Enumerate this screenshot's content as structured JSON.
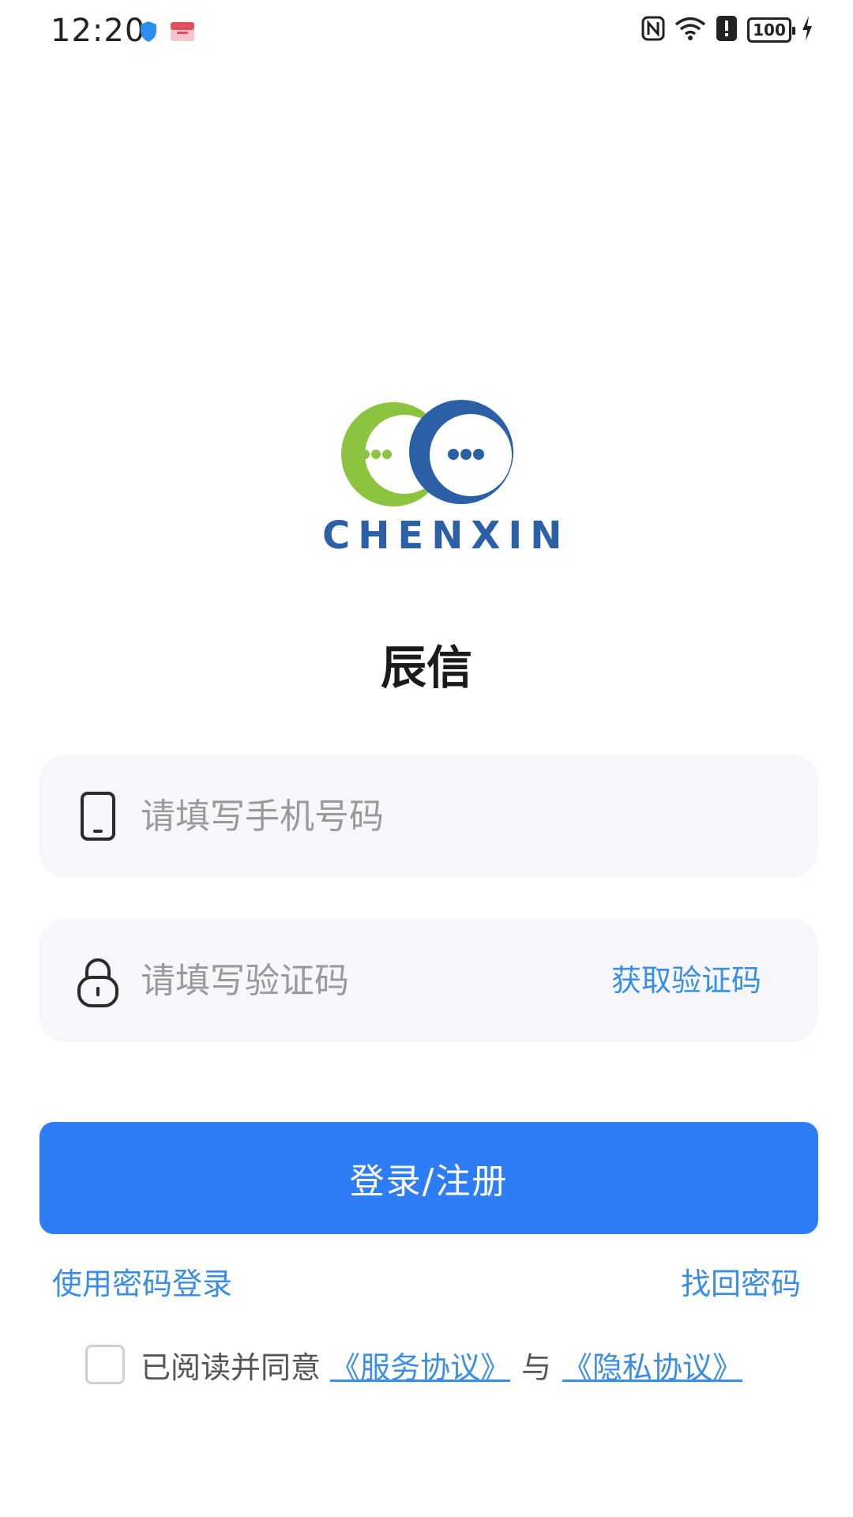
{
  "status_bar": {
    "time": "12:20",
    "battery": "100",
    "icons": [
      "shield-icon",
      "app-notification-icon",
      "nfc-icon",
      "wifi-icon",
      "alert-icon",
      "battery-icon",
      "charging-icon"
    ]
  },
  "logo": {
    "text": "CHENXIN",
    "colors": {
      "green": "#8cc43f",
      "blue": "#2b5fa6"
    }
  },
  "app_name": "辰信",
  "phone_field": {
    "placeholder": "请填写手机号码",
    "value": "",
    "icon": "phone-icon"
  },
  "code_field": {
    "placeholder": "请填写验证码",
    "value": "",
    "icon": "lock-icon",
    "get_code_label": "获取验证码"
  },
  "login_button": "登录/注册",
  "links": {
    "password_login": "使用密码登录",
    "retrieve_password": "找回密码"
  },
  "agreement": {
    "checked": false,
    "prefix": "已阅读并同意",
    "service": "《服务协议》",
    "conjunction": "与",
    "privacy": "《隐私协议》"
  },
  "colors": {
    "primary": "#2f7df6",
    "link": "#3a8ee6",
    "field_bg": "#f6f7fb"
  }
}
